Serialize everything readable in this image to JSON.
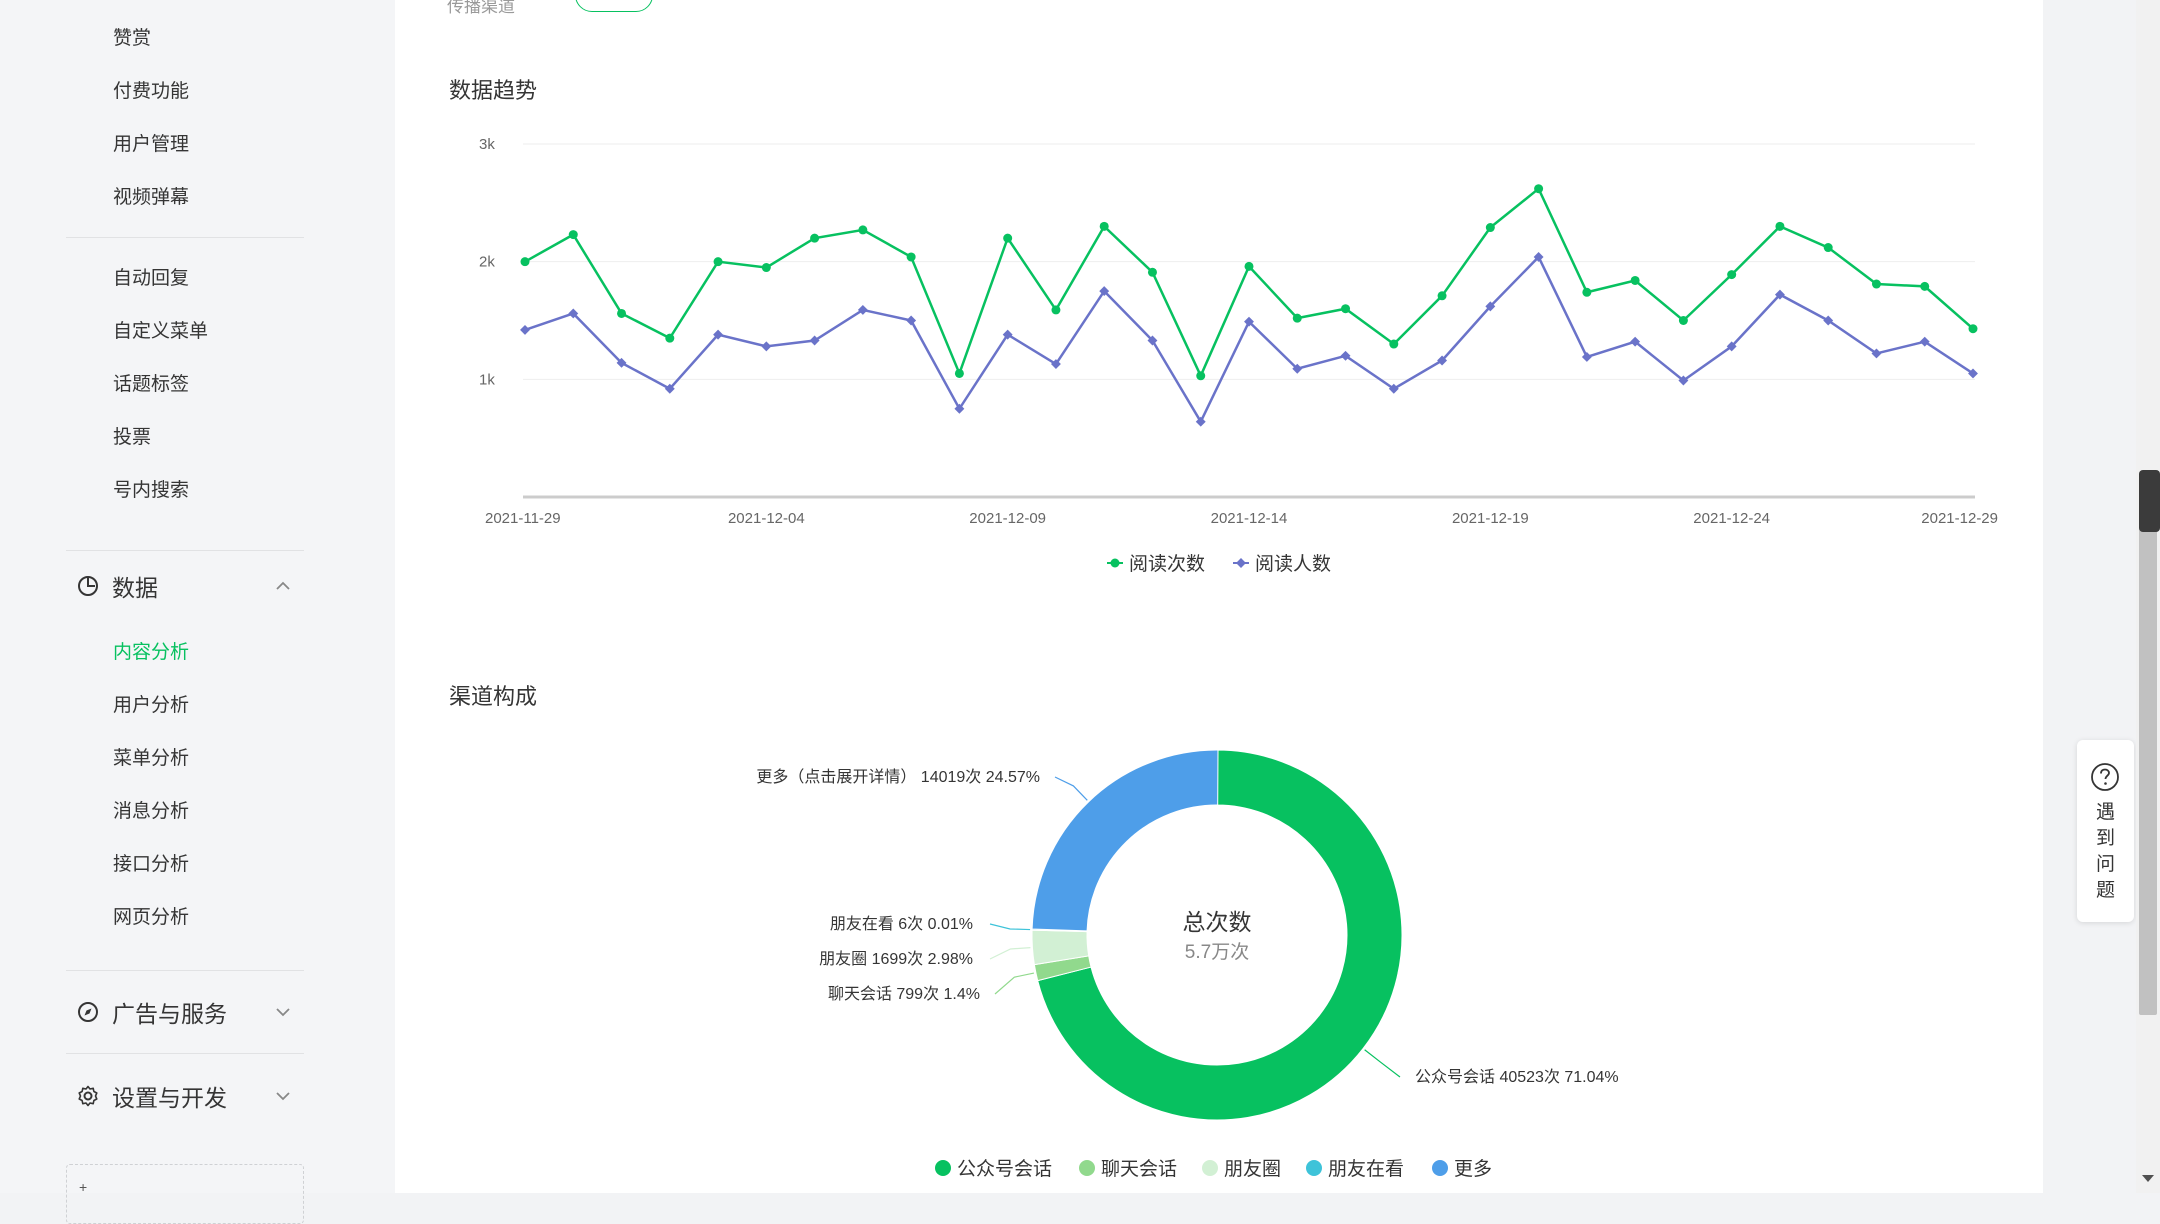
{
  "sidebar": {
    "items_top": [
      "赞赏",
      "付费功能",
      "用户管理",
      "视频弹幕"
    ],
    "items_mid": [
      "自动回复",
      "自定义菜单",
      "话题标签",
      "投票",
      "号内搜索"
    ],
    "data_group": {
      "label": "数据",
      "icon": "pie-clock-icon",
      "expanded": true
    },
    "data_items": [
      "内容分析",
      "用户分析",
      "菜单分析",
      "消息分析",
      "接口分析",
      "网页分析"
    ],
    "data_active": "内容分析",
    "ads_group": {
      "label": "广告与服务",
      "icon": "compass-icon"
    },
    "dev_group": {
      "label": "设置与开发",
      "icon": "gear-icon"
    }
  },
  "main": {
    "top_hint": "传播渠道",
    "trend_title": "数据趋势",
    "channel_title": "渠道构成"
  },
  "help": {
    "label": "遇到问题",
    "icon": "question-icon"
  },
  "colors": {
    "accent": "#07c160",
    "series_reads": "#07c160",
    "series_users": "#6a73c9",
    "pie": [
      "#07c160",
      "#91d98d",
      "#d2f0d4",
      "#3ec3d9",
      "#4e9ee9"
    ]
  },
  "chart_data": [
    {
      "type": "line",
      "x": [
        "2021-11-29",
        "2021-11-30",
        "2021-12-01",
        "2021-12-02",
        "2021-12-03",
        "2021-12-04",
        "2021-12-05",
        "2021-12-06",
        "2021-12-07",
        "2021-12-08",
        "2021-12-09",
        "2021-12-10",
        "2021-12-11",
        "2021-12-12",
        "2021-12-13",
        "2021-12-14",
        "2021-12-15",
        "2021-12-16",
        "2021-12-17",
        "2021-12-18",
        "2021-12-19",
        "2021-12-20",
        "2021-12-21",
        "2021-12-22",
        "2021-12-23",
        "2021-12-24",
        "2021-12-25",
        "2021-12-26",
        "2021-12-27",
        "2021-12-28",
        "2021-12-29"
      ],
      "xticks": [
        "2021-11-29",
        "2021-12-04",
        "2021-12-09",
        "2021-12-14",
        "2021-12-19",
        "2021-12-24",
        "2021-12-29"
      ],
      "yticks": [
        "1k",
        "2k",
        "3k"
      ],
      "ylim": [
        0,
        3000
      ],
      "series": [
        {
          "name": "阅读次数",
          "values": [
            2000,
            2230,
            1560,
            1350,
            2000,
            1950,
            2200,
            2270,
            2040,
            1050,
            2200,
            1590,
            2300,
            1910,
            1030,
            1960,
            1520,
            1600,
            1300,
            1710,
            2290,
            2620,
            1740,
            1840,
            1500,
            1890,
            2300,
            2120,
            1810,
            1790,
            1430
          ]
        },
        {
          "name": "阅读人数",
          "values": [
            1420,
            1560,
            1140,
            920,
            1380,
            1280,
            1330,
            1590,
            1500,
            750,
            1380,
            1130,
            1750,
            1330,
            640,
            1490,
            1090,
            1200,
            920,
            1160,
            1620,
            2040,
            1190,
            1320,
            990,
            1280,
            1720,
            1500,
            1220,
            1320,
            1050
          ]
        }
      ],
      "legend": [
        "阅读次数",
        "阅读人数"
      ]
    },
    {
      "type": "pie",
      "center_title": "总次数",
      "center_value": "5.7万次",
      "slices": [
        {
          "name": "公众号会话",
          "value": 40523,
          "percent": 71.04,
          "label": "公众号会话 40523次 71.04%"
        },
        {
          "name": "聊天会话",
          "value": 799,
          "percent": 1.4,
          "label": "聊天会话 799次 1.4%"
        },
        {
          "name": "朋友圈",
          "value": 1699,
          "percent": 2.98,
          "label": "朋友圈 1699次 2.98%"
        },
        {
          "name": "朋友在看",
          "value": 6,
          "percent": 0.01,
          "label": "朋友在看 6次 0.01%"
        },
        {
          "name": "更多",
          "value": 14019,
          "percent": 24.57,
          "label": "更多（点击展开详情） 14019次 24.57%"
        }
      ],
      "legend": [
        "公众号会话",
        "聊天会话",
        "朋友圈",
        "朋友在看",
        "更多"
      ]
    }
  ]
}
